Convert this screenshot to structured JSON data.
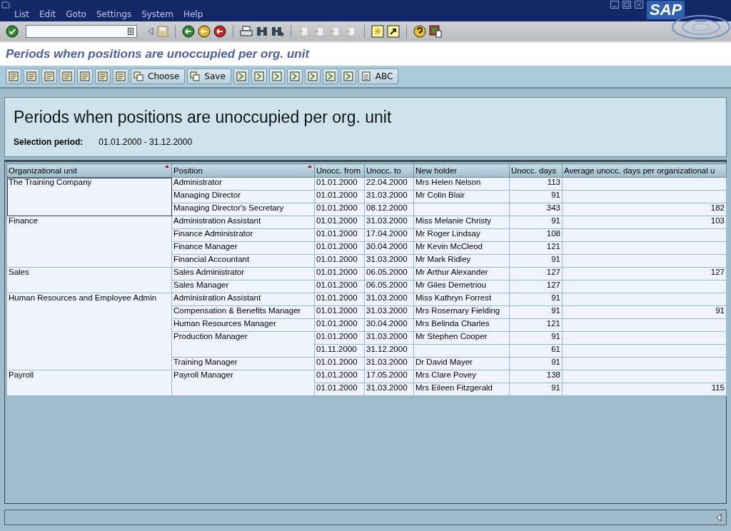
{
  "menu": [
    "List",
    "Edit",
    "Goto",
    "Settings",
    "System",
    "Help"
  ],
  "logo": "SAP",
  "screen_title": "Periods when positions are unoccupied per org. unit",
  "app_toolbar_buttons": [
    "Choose",
    "Save",
    "ABC"
  ],
  "report": {
    "heading": "Periods when positions are unoccupied per org. unit",
    "selection_label": "Selection period:",
    "selection_value": "01.01.2000 - 31.12.2000"
  },
  "table": {
    "columns": [
      {
        "label": "Organizational unit",
        "sorted": true
      },
      {
        "label": "Position",
        "sorted": true
      },
      {
        "label": "Unocc. from",
        "sorted": false
      },
      {
        "label": "Unocc. to",
        "sorted": false
      },
      {
        "label": "New holder",
        "sorted": false
      },
      {
        "label": "Unocc. days",
        "sorted": false
      },
      {
        "label": "Average unocc. days per organizational u",
        "sorted": false
      }
    ],
    "groups": [
      {
        "org_unit": "The Training Company",
        "selected": true,
        "positions": [
          {
            "position": "Administrator",
            "periods": [
              {
                "from": "01.01.2000",
                "to": "22.04.2000",
                "holder": "Mrs Helen Nelson",
                "days": "113"
              }
            ]
          },
          {
            "position": "Managing Director",
            "periods": [
              {
                "from": "01.01.2000",
                "to": "31.03.2000",
                "holder": "Mr Colin Blair",
                "days": "91"
              }
            ]
          },
          {
            "position": "Managing Director's Secretary",
            "periods": [
              {
                "from": "01.01.2000",
                "to": "08.12.2000",
                "days": "343",
                "average": "182"
              }
            ]
          }
        ]
      },
      {
        "org_unit": "Finance",
        "selected": false,
        "positions": [
          {
            "position": "Administration Assistant",
            "periods": [
              {
                "from": "01.01.2000",
                "to": "31.03.2000",
                "holder": "Miss Melanie Christy",
                "days": "91",
                "average": "103"
              }
            ]
          },
          {
            "position": "Finance Administrator",
            "periods": [
              {
                "from": "01.01.2000",
                "to": "17.04.2000",
                "holder": "Mr Roger Lindsay",
                "days": "108"
              }
            ]
          },
          {
            "position": "Finance Manager",
            "periods": [
              {
                "from": "01.01.2000",
                "to": "30.04.2000",
                "holder": "Mr Kevin McCleod",
                "days": "121"
              }
            ]
          },
          {
            "position": "Financial Accountant",
            "periods": [
              {
                "from": "01.01.2000",
                "to": "31.03.2000",
                "holder": "Mr Mark Ridley",
                "days": "91"
              }
            ]
          }
        ]
      },
      {
        "org_unit": "Sales",
        "selected": false,
        "positions": [
          {
            "position": "Sales Administrator",
            "periods": [
              {
                "from": "01.01.2000",
                "to": "06.05.2000",
                "holder": "Mr Arthur Alexander",
                "days": "127",
                "average": "127"
              }
            ]
          },
          {
            "position": "Sales Manager",
            "periods": [
              {
                "from": "01.01.2000",
                "to": "06.05.2000",
                "holder": "Mr Giles Demetriou",
                "days": "127"
              }
            ]
          }
        ]
      },
      {
        "org_unit": "Human Resources and Employee Admin",
        "selected": false,
        "positions": [
          {
            "position": "Administration Assistant",
            "periods": [
              {
                "from": "01.01.2000",
                "to": "31.03.2000",
                "holder": "Miss Kathryn Forrest",
                "days": "91"
              }
            ]
          },
          {
            "position": "Compensation & Benefits Manager",
            "periods": [
              {
                "from": "01.01.2000",
                "to": "31.03.2000",
                "holder": "Mrs Rosemary Fielding",
                "days": "91",
                "average": "91"
              }
            ]
          },
          {
            "position": "Human Resources Manager",
            "periods": [
              {
                "from": "01.01.2000",
                "to": "30.04.2000",
                "holder": "Mrs Belinda Charles",
                "days": "121"
              }
            ]
          },
          {
            "position": "Production Manager",
            "periods": [
              {
                "from": "01.01.2000",
                "to": "31.03.2000",
                "holder": "Mr Stephen Cooper",
                "days": "91"
              },
              {
                "from": "01.11.2000",
                "to": "31.12.2000",
                "days": "61"
              }
            ]
          },
          {
            "position": "Training Manager",
            "periods": [
              {
                "from": "01.01.2000",
                "to": "31.03.2000",
                "holder": "Dr David Mayer",
                "days": "91"
              }
            ]
          }
        ]
      },
      {
        "org_unit": "Payroll",
        "selected": false,
        "positions": [
          {
            "position": "Payroll Manager",
            "periods": [
              {
                "from": "01.01.2000",
                "to": "17.05.2000",
                "holder": "Mrs Clare Povey",
                "days": "138"
              },
              {
                "from": "01.01.2000",
                "to": "31.03.2000",
                "holder": "Mrs Eileen Fitzgerald",
                "days": "91",
                "average": "115"
              }
            ]
          }
        ]
      }
    ]
  }
}
